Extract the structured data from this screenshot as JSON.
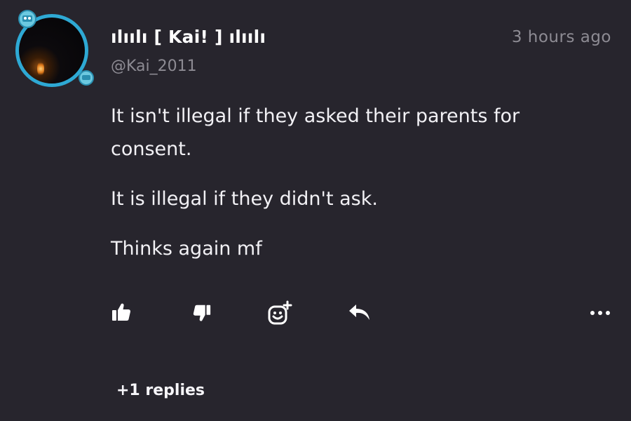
{
  "comment": {
    "username": "ılıılı [ Kai! ] ılıılı",
    "handle": "@Kai_2011",
    "timestamp": "3 hours ago",
    "body": [
      "It isn't illegal if they asked their parents for consent.",
      "It is illegal if they didn't ask.",
      "Thinks again mf"
    ]
  },
  "actions": {
    "like_icon": "thumbs-up-icon",
    "dislike_icon": "thumbs-down-icon",
    "react_icon": "add-reaction-icon",
    "reply_icon": "reply-arrow-icon",
    "more_icon": "more-dots-icon"
  },
  "replies_label": "+1 replies",
  "colors": {
    "background": "#27252d",
    "text_primary": "#f2f1f5",
    "text_muted": "#8d8b93",
    "avatar_ring": "#2ea9d4"
  }
}
